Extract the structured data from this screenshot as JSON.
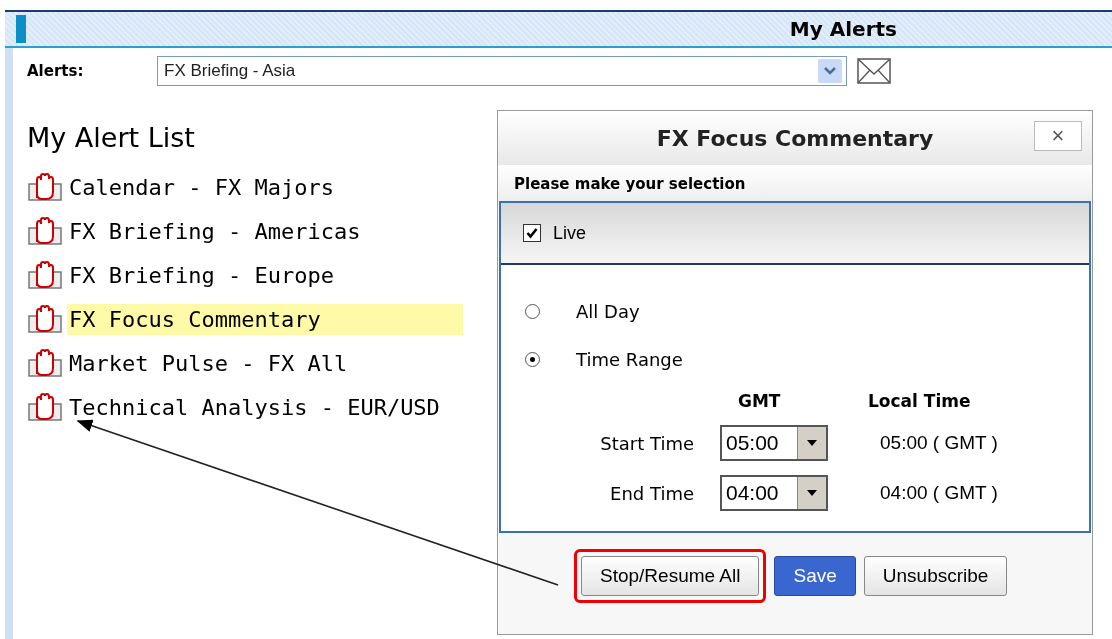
{
  "window": {
    "title": "My Alerts"
  },
  "alerts_field": {
    "label": "Alerts:",
    "value": "FX Briefing - Asia"
  },
  "alert_list": {
    "heading": "My Alert List",
    "items": [
      {
        "label": "Calendar - FX Majors",
        "selected": false
      },
      {
        "label": "FX Briefing - Americas",
        "selected": false
      },
      {
        "label": "FX Briefing - Europe",
        "selected": false
      },
      {
        "label": "FX Focus Commentary",
        "selected": true
      },
      {
        "label": "Market Pulse - FX All",
        "selected": false
      },
      {
        "label": "Technical Analysis - EUR/USD",
        "selected": false
      }
    ]
  },
  "dialog": {
    "title": "FX Focus Commentary",
    "close": "×",
    "prompt": "Please make your selection",
    "live": {
      "label": "Live",
      "checked": true
    },
    "options": [
      {
        "label": "All Day",
        "selected": false
      },
      {
        "label": "Time Range",
        "selected": true
      }
    ],
    "columns": [
      "GMT",
      "Local Time"
    ],
    "times": [
      {
        "label": "Start Time",
        "value": "05:00",
        "local": "05:00 ( GMT )"
      },
      {
        "label": "End Time",
        "value": "04:00",
        "local": "04:00 ( GMT )"
      }
    ],
    "buttons": [
      {
        "label": "Stop/Resume All",
        "kind": "plain",
        "highlighted": true
      },
      {
        "label": "Save",
        "kind": "primary",
        "highlighted": false
      },
      {
        "label": "Unsubscribe",
        "kind": "plain",
        "highlighted": false
      }
    ]
  }
}
